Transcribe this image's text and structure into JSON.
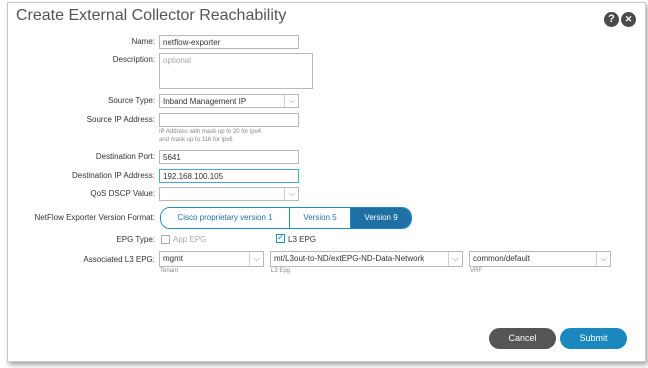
{
  "dialog": {
    "title": "Create External Collector Reachability",
    "help_label": "?",
    "close_label": "✕"
  },
  "form": {
    "name": {
      "label": "Name:",
      "value": "netflow-exporter"
    },
    "description": {
      "label": "Description:",
      "placeholder": "optional"
    },
    "source_type": {
      "label": "Source Type:",
      "value": "Inband Management IP"
    },
    "source_ip": {
      "label": "Source IP Address:",
      "value": "",
      "helper_1": "IP Address with mask up to 20 for ipv4",
      "helper_2": "and mask up to 116 for ipv6"
    },
    "destination_port": {
      "label": "Destination Port:",
      "value": "5641"
    },
    "destination_ip": {
      "label": "Destination IP Address:",
      "value": "192.168.100.105"
    },
    "qos_dscp": {
      "label": "QoS DSCP Value:",
      "value": ""
    },
    "netflow_version": {
      "label": "NetFlow Exporter Version Format:",
      "options": [
        "Cisco proprietary version 1",
        "Version 5",
        "Version 9"
      ],
      "selected": "Version 9"
    },
    "epg_type": {
      "label": "EPG Type:",
      "app_epg": {
        "label": "App EPG",
        "checked": false
      },
      "l3_epg": {
        "label": "L3 EPG",
        "checked": true
      }
    },
    "l3_epg": {
      "label": "Associated L3 EPG:",
      "tenant": {
        "value": "mgmt",
        "sublabel": "Tenant"
      },
      "epg": {
        "value": "mt/L3out-to-ND/extEPG-ND-Data-Network",
        "sublabel": "L3 Epg"
      },
      "vrf": {
        "value": "common/default",
        "sublabel": "VRF"
      }
    }
  },
  "footer": {
    "cancel_label": "Cancel",
    "submit_label": "Submit"
  },
  "colors": {
    "accent": "#1e6fa3",
    "submit": "#1a87bd",
    "cancel": "#555555"
  },
  "icons": [
    "help-icon",
    "close-icon",
    "chevron-down-icon",
    "checkbox-icon"
  ]
}
